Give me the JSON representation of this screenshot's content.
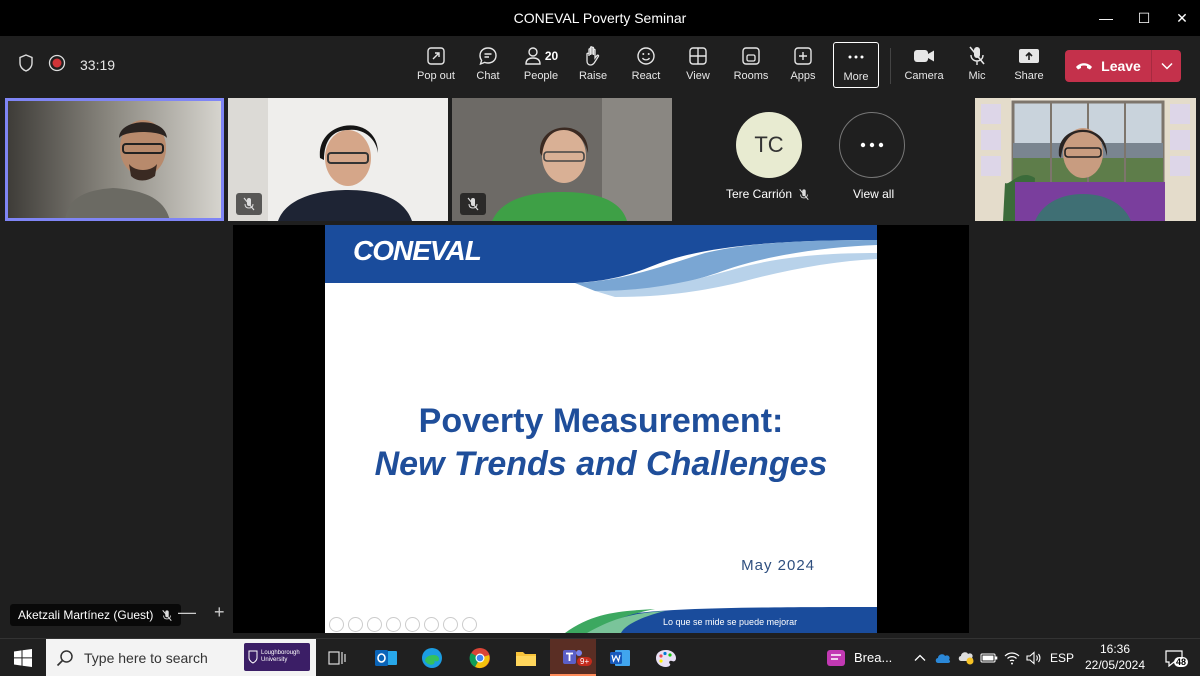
{
  "window": {
    "title": "CONEVAL Poverty Seminar",
    "minimize": "—",
    "maximize": "☐",
    "close": "✕"
  },
  "meeting": {
    "timer": "33:19"
  },
  "toolbar": {
    "pop_out": "Pop out",
    "chat": "Chat",
    "people": "People",
    "people_count": "20",
    "raise": "Raise",
    "react": "React",
    "view": "View",
    "rooms": "Rooms",
    "apps": "Apps",
    "more": "More",
    "camera": "Camera",
    "mic": "Mic",
    "share": "Share",
    "leave": "Leave"
  },
  "participants": {
    "tc_initials": "TC",
    "tc_name": "Tere Carrión",
    "view_all": "View all"
  },
  "slide": {
    "logo": "CONEVAL",
    "title_line1": "Poverty Measurement:",
    "title_line2": "New Trends and Challenges",
    "date": "May 2024",
    "tagline": "Lo que se mide se puede mejorar"
  },
  "stage": {
    "presenter_name": "Aketzali Martínez (Guest)"
  },
  "taskbar": {
    "search_placeholder": "Type here to search",
    "loughborough": "Loughborough University",
    "teams_badge": "9+",
    "breakout": "Brea...",
    "language": "ESP",
    "time": "16:36",
    "date": "22/05/2024",
    "notifications": "48"
  }
}
